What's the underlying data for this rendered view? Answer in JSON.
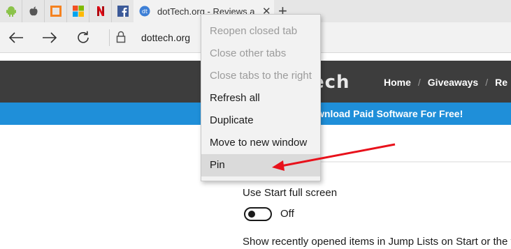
{
  "tabs": {
    "pinned": [
      {
        "icon": "android-icon",
        "color": "#8bc34a"
      },
      {
        "icon": "apple-icon",
        "color": "#555555"
      },
      {
        "icon": "square-frame-icon",
        "color": "#f58220"
      },
      {
        "icon": "microsoft-icon",
        "color": "#f25022"
      },
      {
        "icon": "netflix-icon",
        "color": "#e50914"
      },
      {
        "icon": "facebook-icon",
        "color": "#3b5998"
      }
    ],
    "active": {
      "title": "dotTech.org - Reviews a",
      "icon": "dottech-icon",
      "close": "✕"
    },
    "new_tab": "+"
  },
  "address_bar": {
    "url": "dottech.org"
  },
  "site": {
    "logo_fragment": "ech",
    "nav": [
      "Home",
      "Giveaways",
      "Re"
    ],
    "nav_separator": "/",
    "banner": "wnload Paid Software For Free!"
  },
  "settings": {
    "label_1": "Use Start full screen",
    "toggle_state": "Off",
    "label_2": "Show recently opened items in Jump Lists on Start or the t"
  },
  "context_menu": {
    "items": [
      {
        "label": "Reopen closed tab",
        "enabled": false
      },
      {
        "label": "Close other tabs",
        "enabled": false
      },
      {
        "label": "Close tabs to the right",
        "enabled": false
      },
      {
        "label": "Refresh all",
        "enabled": true
      },
      {
        "label": "Duplicate",
        "enabled": true
      },
      {
        "label": "Move to new window",
        "enabled": true
      },
      {
        "label": "Pin",
        "enabled": true,
        "highlighted": true
      }
    ]
  },
  "colors": {
    "annotation_arrow": "#e8111b",
    "banner": "#1f8fd9",
    "site_header": "#3d3d3d"
  }
}
